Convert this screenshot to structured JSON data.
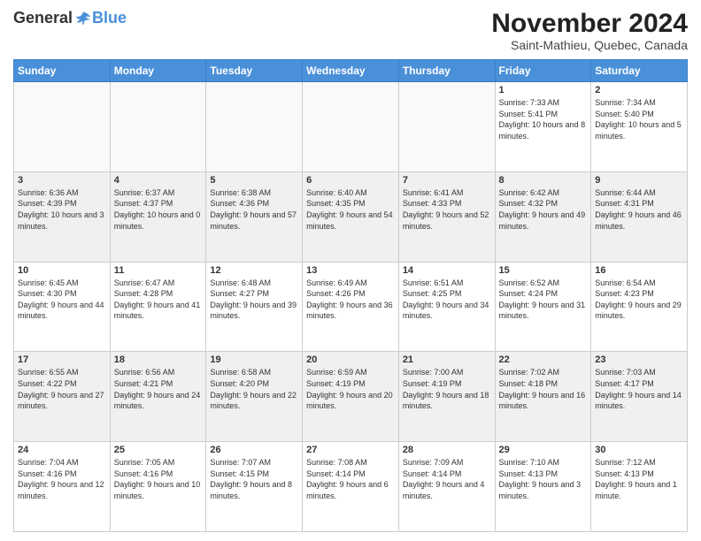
{
  "logo": {
    "general": "General",
    "blue": "Blue"
  },
  "header": {
    "month": "November 2024",
    "location": "Saint-Mathieu, Quebec, Canada"
  },
  "weekdays": [
    "Sunday",
    "Monday",
    "Tuesday",
    "Wednesday",
    "Thursday",
    "Friday",
    "Saturday"
  ],
  "weeks": [
    [
      {
        "day": "",
        "info": ""
      },
      {
        "day": "",
        "info": ""
      },
      {
        "day": "",
        "info": ""
      },
      {
        "day": "",
        "info": ""
      },
      {
        "day": "",
        "info": ""
      },
      {
        "day": "1",
        "info": "Sunrise: 7:33 AM\nSunset: 5:41 PM\nDaylight: 10 hours and 8 minutes."
      },
      {
        "day": "2",
        "info": "Sunrise: 7:34 AM\nSunset: 5:40 PM\nDaylight: 10 hours and 5 minutes."
      }
    ],
    [
      {
        "day": "3",
        "info": "Sunrise: 6:36 AM\nSunset: 4:39 PM\nDaylight: 10 hours and 3 minutes."
      },
      {
        "day": "4",
        "info": "Sunrise: 6:37 AM\nSunset: 4:37 PM\nDaylight: 10 hours and 0 minutes."
      },
      {
        "day": "5",
        "info": "Sunrise: 6:38 AM\nSunset: 4:36 PM\nDaylight: 9 hours and 57 minutes."
      },
      {
        "day": "6",
        "info": "Sunrise: 6:40 AM\nSunset: 4:35 PM\nDaylight: 9 hours and 54 minutes."
      },
      {
        "day": "7",
        "info": "Sunrise: 6:41 AM\nSunset: 4:33 PM\nDaylight: 9 hours and 52 minutes."
      },
      {
        "day": "8",
        "info": "Sunrise: 6:42 AM\nSunset: 4:32 PM\nDaylight: 9 hours and 49 minutes."
      },
      {
        "day": "9",
        "info": "Sunrise: 6:44 AM\nSunset: 4:31 PM\nDaylight: 9 hours and 46 minutes."
      }
    ],
    [
      {
        "day": "10",
        "info": "Sunrise: 6:45 AM\nSunset: 4:30 PM\nDaylight: 9 hours and 44 minutes."
      },
      {
        "day": "11",
        "info": "Sunrise: 6:47 AM\nSunset: 4:28 PM\nDaylight: 9 hours and 41 minutes."
      },
      {
        "day": "12",
        "info": "Sunrise: 6:48 AM\nSunset: 4:27 PM\nDaylight: 9 hours and 39 minutes."
      },
      {
        "day": "13",
        "info": "Sunrise: 6:49 AM\nSunset: 4:26 PM\nDaylight: 9 hours and 36 minutes."
      },
      {
        "day": "14",
        "info": "Sunrise: 6:51 AM\nSunset: 4:25 PM\nDaylight: 9 hours and 34 minutes."
      },
      {
        "day": "15",
        "info": "Sunrise: 6:52 AM\nSunset: 4:24 PM\nDaylight: 9 hours and 31 minutes."
      },
      {
        "day": "16",
        "info": "Sunrise: 6:54 AM\nSunset: 4:23 PM\nDaylight: 9 hours and 29 minutes."
      }
    ],
    [
      {
        "day": "17",
        "info": "Sunrise: 6:55 AM\nSunset: 4:22 PM\nDaylight: 9 hours and 27 minutes."
      },
      {
        "day": "18",
        "info": "Sunrise: 6:56 AM\nSunset: 4:21 PM\nDaylight: 9 hours and 24 minutes."
      },
      {
        "day": "19",
        "info": "Sunrise: 6:58 AM\nSunset: 4:20 PM\nDaylight: 9 hours and 22 minutes."
      },
      {
        "day": "20",
        "info": "Sunrise: 6:59 AM\nSunset: 4:19 PM\nDaylight: 9 hours and 20 minutes."
      },
      {
        "day": "21",
        "info": "Sunrise: 7:00 AM\nSunset: 4:19 PM\nDaylight: 9 hours and 18 minutes."
      },
      {
        "day": "22",
        "info": "Sunrise: 7:02 AM\nSunset: 4:18 PM\nDaylight: 9 hours and 16 minutes."
      },
      {
        "day": "23",
        "info": "Sunrise: 7:03 AM\nSunset: 4:17 PM\nDaylight: 9 hours and 14 minutes."
      }
    ],
    [
      {
        "day": "24",
        "info": "Sunrise: 7:04 AM\nSunset: 4:16 PM\nDaylight: 9 hours and 12 minutes."
      },
      {
        "day": "25",
        "info": "Sunrise: 7:05 AM\nSunset: 4:16 PM\nDaylight: 9 hours and 10 minutes."
      },
      {
        "day": "26",
        "info": "Sunrise: 7:07 AM\nSunset: 4:15 PM\nDaylight: 9 hours and 8 minutes."
      },
      {
        "day": "27",
        "info": "Sunrise: 7:08 AM\nSunset: 4:14 PM\nDaylight: 9 hours and 6 minutes."
      },
      {
        "day": "28",
        "info": "Sunrise: 7:09 AM\nSunset: 4:14 PM\nDaylight: 9 hours and 4 minutes."
      },
      {
        "day": "29",
        "info": "Sunrise: 7:10 AM\nSunset: 4:13 PM\nDaylight: 9 hours and 3 minutes."
      },
      {
        "day": "30",
        "info": "Sunrise: 7:12 AM\nSunset: 4:13 PM\nDaylight: 9 hours and 1 minute."
      }
    ]
  ]
}
